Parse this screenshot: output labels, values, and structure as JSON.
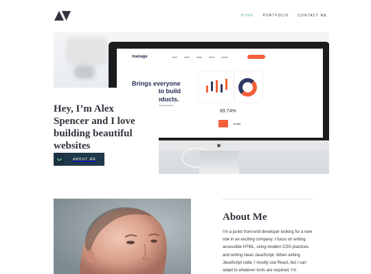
{
  "header": {
    "nav": [
      {
        "label": "HOME",
        "active": true
      },
      {
        "label": "PORTFOLIO",
        "active": false
      },
      {
        "label": "CONTACT ME",
        "active": false
      }
    ]
  },
  "hero": {
    "title": "Hey, I’m Alex Spencer and I love building beautiful websites",
    "button_label": "ABOUT ME",
    "screen": {
      "brand": "manage",
      "headline": "Brings everyone together to build better products.",
      "stat_percent": "89.74%",
      "stat_small": "56.28%"
    }
  },
  "about": {
    "title": "About Me",
    "text": "I’m a junior front-end developer looking for a new role in an exciting company. I focus on writing accessible HTML, using modern CSS practices and writing clean JavaScript. When writing JavaScript code, I mostly use React, but I can adapt to whatever tools are required. I’m"
  },
  "colors": {
    "dark": "#33323d",
    "accent": "#5fb4a2",
    "button": "#203a4c"
  },
  "icons": {
    "logo": "logo-icon",
    "button_icon": "chevron-down-icon"
  }
}
